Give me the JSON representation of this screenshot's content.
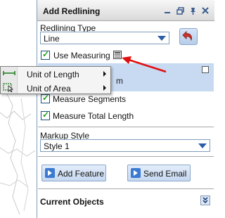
{
  "panel": {
    "title": "Add Redlining"
  },
  "redlining_type": {
    "label": "Redlining Type",
    "value": "Line"
  },
  "measuring": {
    "use_label": "Use Measuring",
    "use_checked": true,
    "faded_text": "m",
    "segments_label": "Measure Segments",
    "segments_checked": true,
    "total_label": "Measure Total Length",
    "total_checked": true
  },
  "markup_style": {
    "label": "Markup Style",
    "value": "Style 1"
  },
  "buttons": {
    "add_feature": "Add Feature",
    "send_email": "Send Email"
  },
  "current_objects": {
    "label": "Current Objects"
  },
  "popup_menu": {
    "items": [
      {
        "label": "Unit of Length",
        "icon": "ruler-icon"
      },
      {
        "label": "Unit of Area",
        "icon": "area-cursor-icon"
      }
    ]
  },
  "colors": {
    "accent_blue": "#2a5ca8",
    "options_bg": "#c8daf2",
    "arrow_red": "#e01010",
    "check_green": "#21a121"
  }
}
